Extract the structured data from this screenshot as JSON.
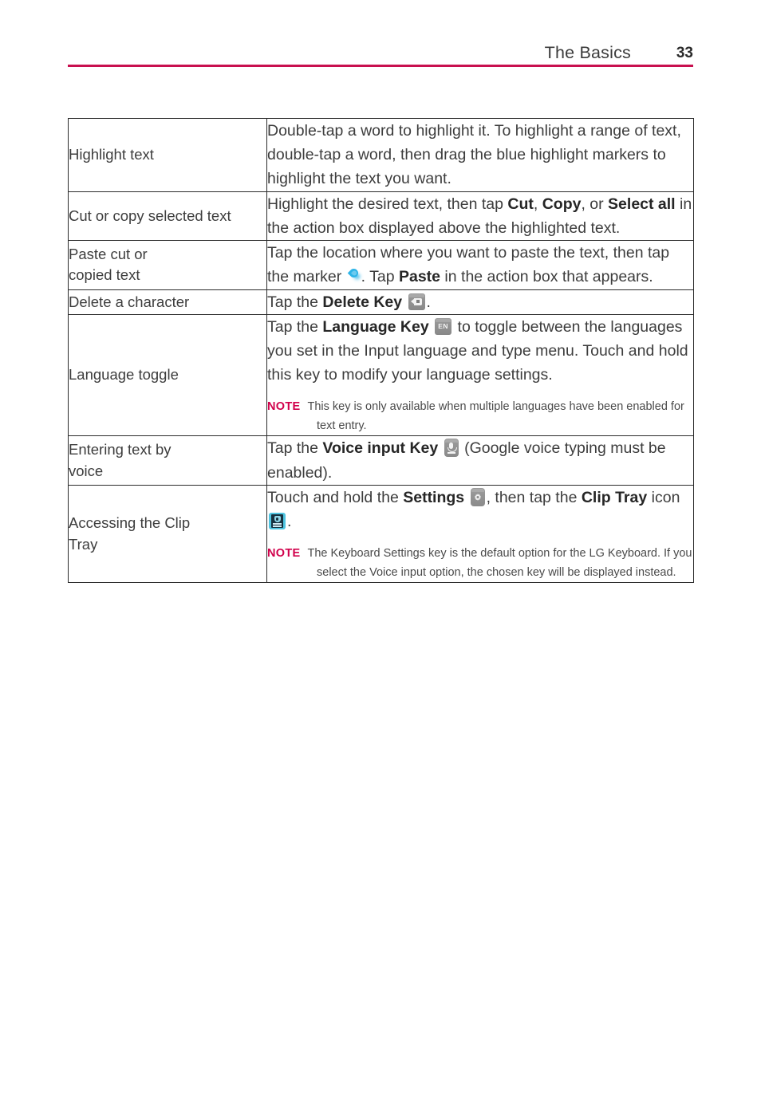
{
  "header": {
    "title": "The Basics",
    "page_number": "33",
    "rule_color": "#c8104f"
  },
  "note_label": "NOTE",
  "note_color": "#d1004b",
  "table": {
    "rows": [
      {
        "label": "Highlight text",
        "desc_parts": [
          {
            "type": "text",
            "text": "Double-tap a word to highlight it. To highlight a range of text, double-tap a word, then drag the blue highlight markers to highlight the text you want."
          }
        ]
      },
      {
        "label": "Cut or copy selected text",
        "desc_parts": [
          {
            "type": "text",
            "text": "Highlight the desired text, then tap "
          },
          {
            "type": "bold",
            "text": "Cut"
          },
          {
            "type": "text",
            "text": ", "
          },
          {
            "type": "bold",
            "text": "Copy"
          },
          {
            "type": "text",
            "text": ", or "
          },
          {
            "type": "bold",
            "text": "Select all"
          },
          {
            "type": "text",
            "text": " in the action box displayed above the highlighted text."
          }
        ]
      },
      {
        "label": "Paste cut or\ncopied text",
        "desc_parts": [
          {
            "type": "text",
            "text": "Tap the location where you want to paste the text, then tap the marker "
          },
          {
            "type": "icon",
            "icon": "text-marker-icon"
          },
          {
            "type": "text",
            "text": ". Tap "
          },
          {
            "type": "bold",
            "text": "Paste"
          },
          {
            "type": "text",
            "text": " in the action box that appears."
          }
        ]
      },
      {
        "label": "Delete a character",
        "desc_parts": [
          {
            "type": "text",
            "text": "Tap the "
          },
          {
            "type": "bold",
            "text": "Delete Key"
          },
          {
            "type": "text",
            "text": " "
          },
          {
            "type": "icon",
            "icon": "delete-key-icon"
          },
          {
            "type": "text",
            "text": "."
          }
        ]
      },
      {
        "label": "Language toggle",
        "desc_parts": [
          {
            "type": "text",
            "text": "Tap the "
          },
          {
            "type": "bold",
            "text": "Language Key"
          },
          {
            "type": "text",
            "text": " "
          },
          {
            "type": "icon",
            "icon": "language-key-icon",
            "icon_label": "EN"
          },
          {
            "type": "text",
            "text": " to toggle between the languages you set in the Input language and type menu. Touch and hold this key to modify your language settings."
          }
        ],
        "note": "This key is only available when multiple languages have been enabled for text entry."
      },
      {
        "label": "Entering text by\nvoice",
        "desc_parts": [
          {
            "type": "text",
            "text": "Tap the "
          },
          {
            "type": "bold",
            "text": "Voice input Key"
          },
          {
            "type": "text",
            "text": " "
          },
          {
            "type": "icon",
            "icon": "voice-input-key-icon"
          },
          {
            "type": "text",
            "text": " (Google voice typing must be enabled)."
          }
        ]
      },
      {
        "label": "Accessing the Clip\nTray",
        "desc_parts": [
          {
            "type": "text",
            "text": "Touch and hold the "
          },
          {
            "type": "bold",
            "text": "Settings"
          },
          {
            "type": "text",
            "text": " "
          },
          {
            "type": "icon",
            "icon": "settings-key-icon"
          },
          {
            "type": "text",
            "text": ", then tap the "
          },
          {
            "type": "bold",
            "text": "Clip Tray"
          },
          {
            "type": "text",
            "text": " icon "
          },
          {
            "type": "icon",
            "icon": "clip-tray-icon"
          },
          {
            "type": "text",
            "text": "."
          }
        ],
        "note": "The Keyboard Settings key is the default option for the LG Keyboard. If you select the Voice input option, the chosen key will be displayed instead."
      }
    ]
  }
}
